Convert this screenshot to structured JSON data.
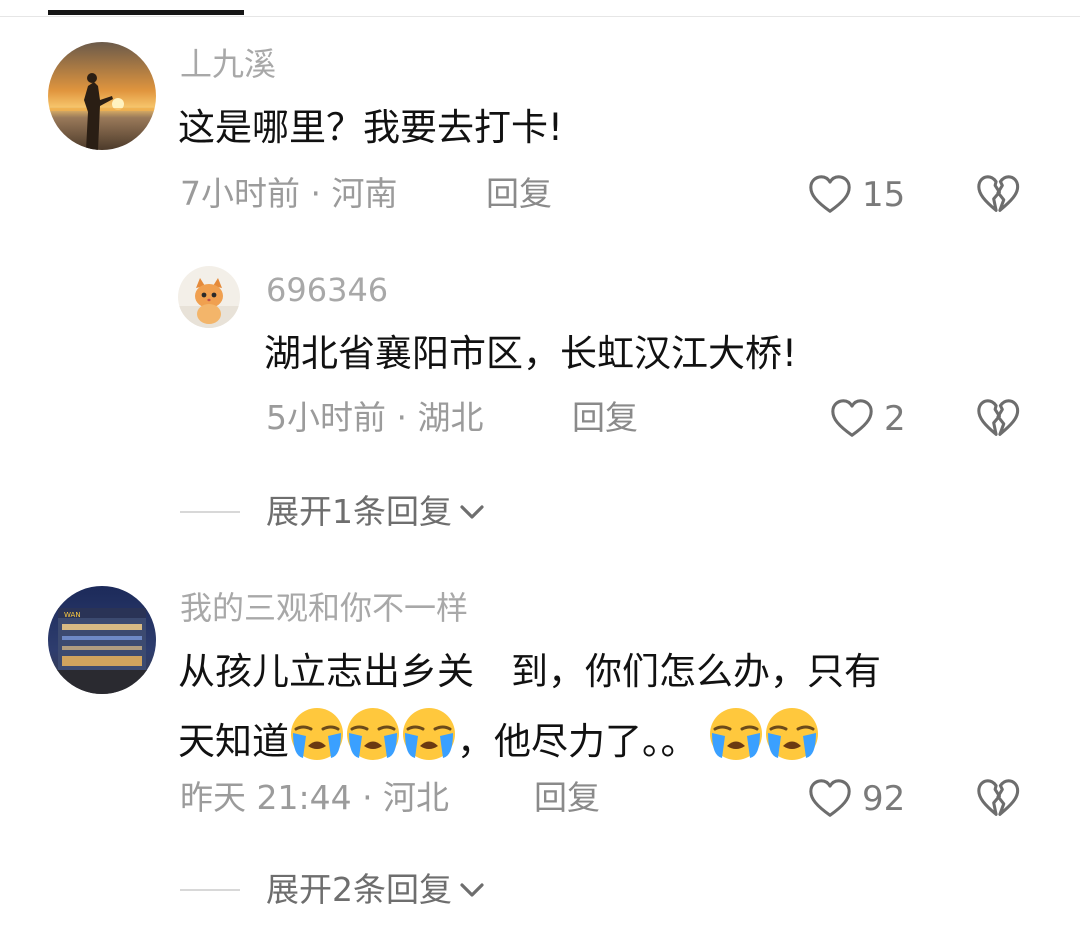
{
  "header": {
    "active_tab_indicator": "tab-indicator"
  },
  "comments": [
    {
      "username": "丄九溪",
      "text": "这是哪里？我要去打卡!",
      "meta": "7小时前 · 河南",
      "reply_label": "回复",
      "likes": "15",
      "avatar": "sunset-avatar"
    },
    {
      "username": "696346",
      "text": "湖北省襄阳市区，长虹汉江大桥!",
      "meta": "5小时前 · 湖北",
      "reply_label": "回复",
      "likes": "2",
      "avatar": "cat-avatar"
    },
    {
      "username": "我的三观和你不一样",
      "text_line1": "从孩儿立志出乡关　到，你们怎么办，只有",
      "text_line2_a": "天知道",
      "text_line2_b": "，他尽力了。。",
      "meta": "昨天 21:44 · 河北",
      "reply_label": "回复",
      "likes": "92",
      "avatar": "building-avatar"
    }
  ],
  "expand_replies": [
    {
      "label": "展开1条回复"
    },
    {
      "label": "展开2条回复"
    }
  ],
  "icons": {
    "like": "heart-outline-icon",
    "dislike": "broken-heart-icon",
    "expand": "chevron-down-icon",
    "crying_emoji": "loudly-crying-face"
  },
  "colors": {
    "username": "#a8a8a8",
    "meta": "#9b9b9b",
    "text": "#111111"
  }
}
